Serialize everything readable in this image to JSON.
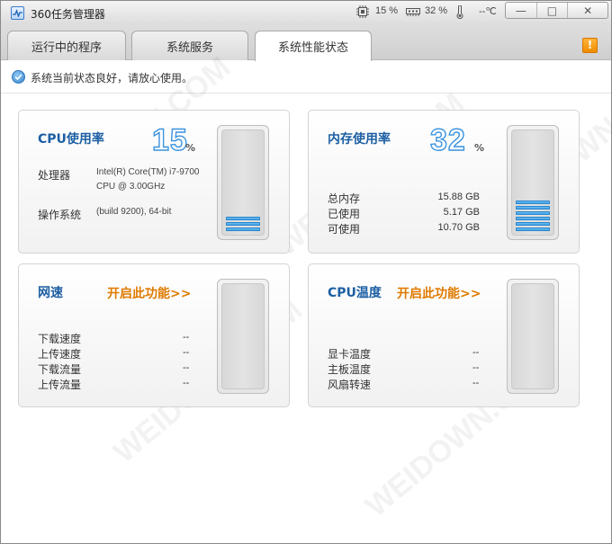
{
  "titlebar": {
    "title": "360任务管理器",
    "cpu_stat": "15 %",
    "mem_stat": "32 %",
    "temp_stat": "--℃",
    "minimize_label": "—",
    "restore_label": "□",
    "close_label": "✕"
  },
  "tabs": [
    {
      "label": "运行中的程序"
    },
    {
      "label": "系统服务"
    },
    {
      "label": "系统性能状态"
    }
  ],
  "warn_label": "!",
  "status": {
    "text": "系统当前状态良好，请放心使用。"
  },
  "cpu_panel": {
    "title": "CPU使用率",
    "percent": 15,
    "percent_text": "15",
    "pct_sign": "%",
    "processor_label": "处理器",
    "processor_line1": "Intel(R) Core(TM) i7-9700",
    "processor_line2": "CPU @ 3.00GHz",
    "os_label": "操作系统",
    "os_value": "(build 9200), 64-bit"
  },
  "mem_panel": {
    "title": "内存使用率",
    "percent": 32,
    "percent_text": "32",
    "pct_sign": "%",
    "rows": [
      {
        "label": "总内存",
        "value": "15.88 GB"
      },
      {
        "label": "已使用",
        "value": "5.17 GB"
      },
      {
        "label": "可使用",
        "value": "10.70 GB"
      }
    ]
  },
  "net_panel": {
    "title": "网速",
    "enable_link": "开启此功能>>",
    "rows": [
      {
        "label": "下载速度",
        "value": "--"
      },
      {
        "label": "上传速度",
        "value": "--"
      },
      {
        "label": "下载流量",
        "value": "--"
      },
      {
        "label": "上传流量",
        "value": "--"
      }
    ]
  },
  "temp_panel": {
    "title": "CPU温度",
    "enable_link": "开启此功能>>",
    "rows": [
      {
        "label": "显卡温度",
        "value": "--"
      },
      {
        "label": "主板温度",
        "value": "--"
      },
      {
        "label": "风扇转速",
        "value": "--"
      }
    ]
  },
  "colors": {
    "accent": "#1d5fa3",
    "link": "#e07a00",
    "gauge": "#2e97e2"
  }
}
